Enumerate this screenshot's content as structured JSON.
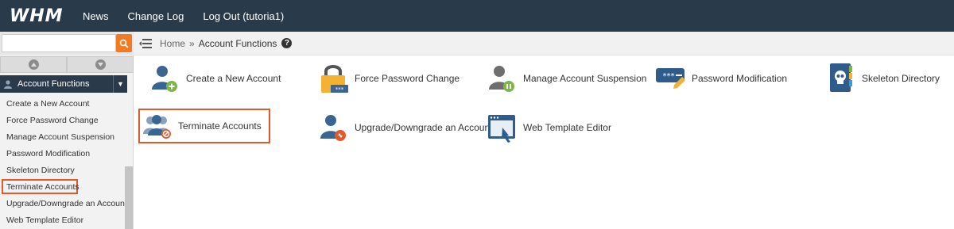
{
  "topbar": {
    "logo": "WHM",
    "nav": [
      "News",
      "Change Log",
      "Log Out (tutoria1)"
    ]
  },
  "sidebar": {
    "search": {
      "value": "",
      "placeholder": ""
    },
    "section_title": "Account Functions",
    "items": [
      {
        "label": "Create a New Account",
        "active": false
      },
      {
        "label": "Force Password Change",
        "active": false
      },
      {
        "label": "Manage Account Suspension",
        "active": false
      },
      {
        "label": "Password Modification",
        "active": false
      },
      {
        "label": "Skeleton Directory",
        "active": false
      },
      {
        "label": "Terminate Accounts",
        "active": true
      },
      {
        "label": "Upgrade/Downgrade an Account",
        "active": false
      },
      {
        "label": "Web Template Editor",
        "active": false
      }
    ]
  },
  "breadcrumb": {
    "home": "Home",
    "separator": "»",
    "current": "Account Functions"
  },
  "main": {
    "tiles": [
      {
        "label": "Create a New Account",
        "icon": "user-add-icon"
      },
      {
        "label": "Force Password Change",
        "icon": "padlock-icon"
      },
      {
        "label": "Manage Account Suspension",
        "icon": "user-suspend-icon"
      },
      {
        "label": "Password Modification",
        "icon": "password-edit-icon"
      },
      {
        "label": "Skeleton Directory",
        "icon": "skull-book-icon"
      },
      {
        "label": "Terminate Accounts",
        "icon": "users-terminate-icon"
      },
      {
        "label": "Upgrade/Downgrade an Account",
        "icon": "user-upgrade-icon"
      },
      {
        "label": "Web Template Editor",
        "icon": "browser-edit-icon"
      }
    ]
  },
  "colors": {
    "topbar": "#293a4a",
    "accent": "#f07b23",
    "highlight": "#e05a2b",
    "icon_blue": "#2f5c8a"
  }
}
